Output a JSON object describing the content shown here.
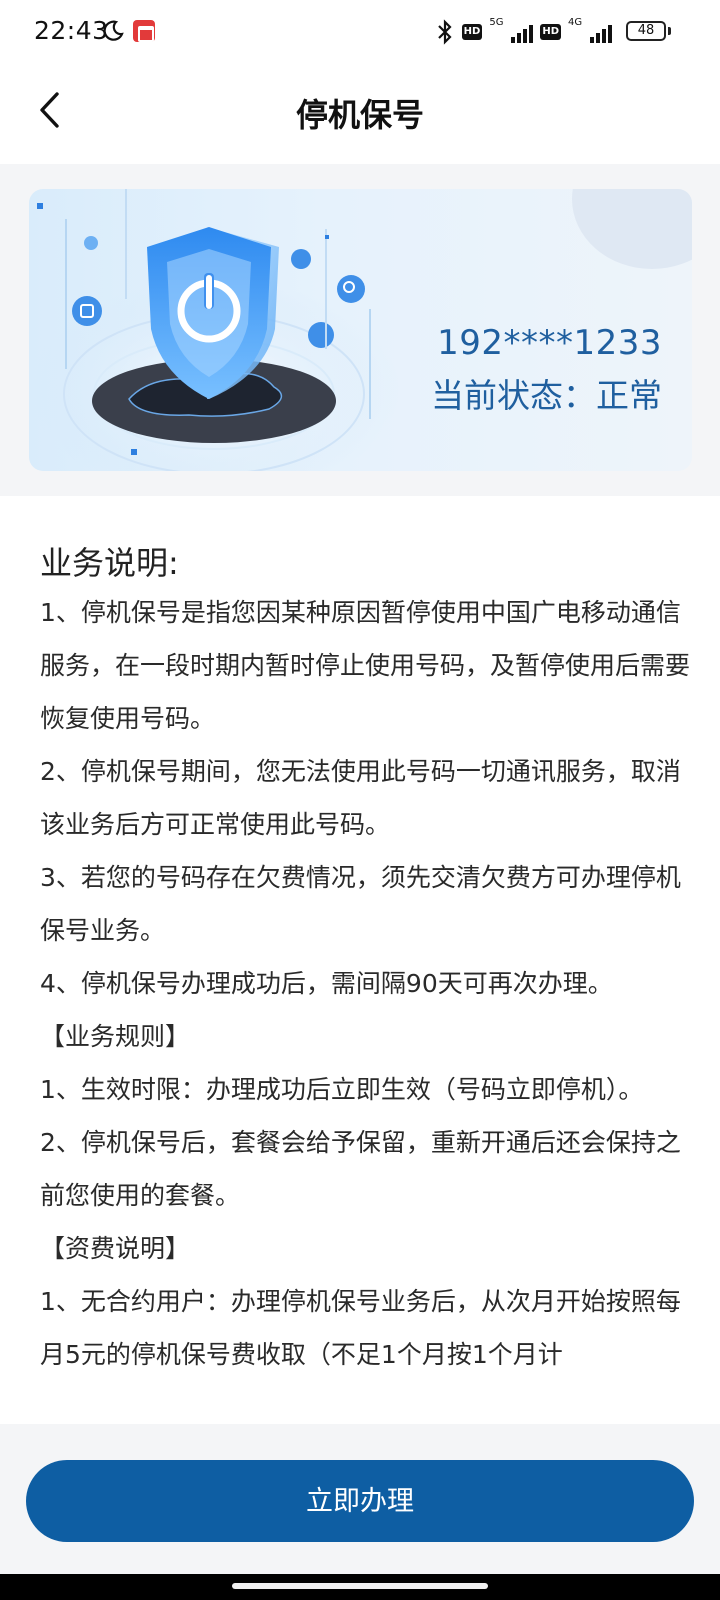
{
  "status_bar": {
    "time": "22:43",
    "network_1": "5G",
    "network_2": "4G",
    "hd_1": "HD",
    "hd_2": "HD",
    "battery": "48"
  },
  "header": {
    "title": "停机保号",
    "back_icon": "chevron-left-icon"
  },
  "banner": {
    "phone_number": "192****1233",
    "status_text": "当前状态：正常",
    "accent_color": "#1f5f9f"
  },
  "content": {
    "section_title": "业务说明:",
    "paragraphs": [
      "1、停机保号是指您因某种原因暂停使用中国广电移动通信服务，在一段时期内暂时停止使用号码，及暂停使用后需要恢复使用号码。",
      "2、停机保号期间，您无法使用此号码一切通讯服务，取消该业务后方可正常使用此号码。",
      "3、若您的号码存在欠费情况，须先交清欠费方可办理停机保号业务。",
      "4、停机保号办理成功后，需间隔90天可再次办理。",
      "【业务规则】",
      "1、生效时限：办理成功后立即生效（号码立即停机）。",
      "2、停机保号后，套餐会给予保留，重新开通后还会保持之前您使用的套餐。",
      "【资费说明】",
      "1、无合约用户：办理停机保号业务后，从次月开始按照每月5元的停机保号费收取（不足1个月按1个月计"
    ]
  },
  "footer": {
    "action_label": "立即办理",
    "button_color": "#0e5ea3"
  }
}
